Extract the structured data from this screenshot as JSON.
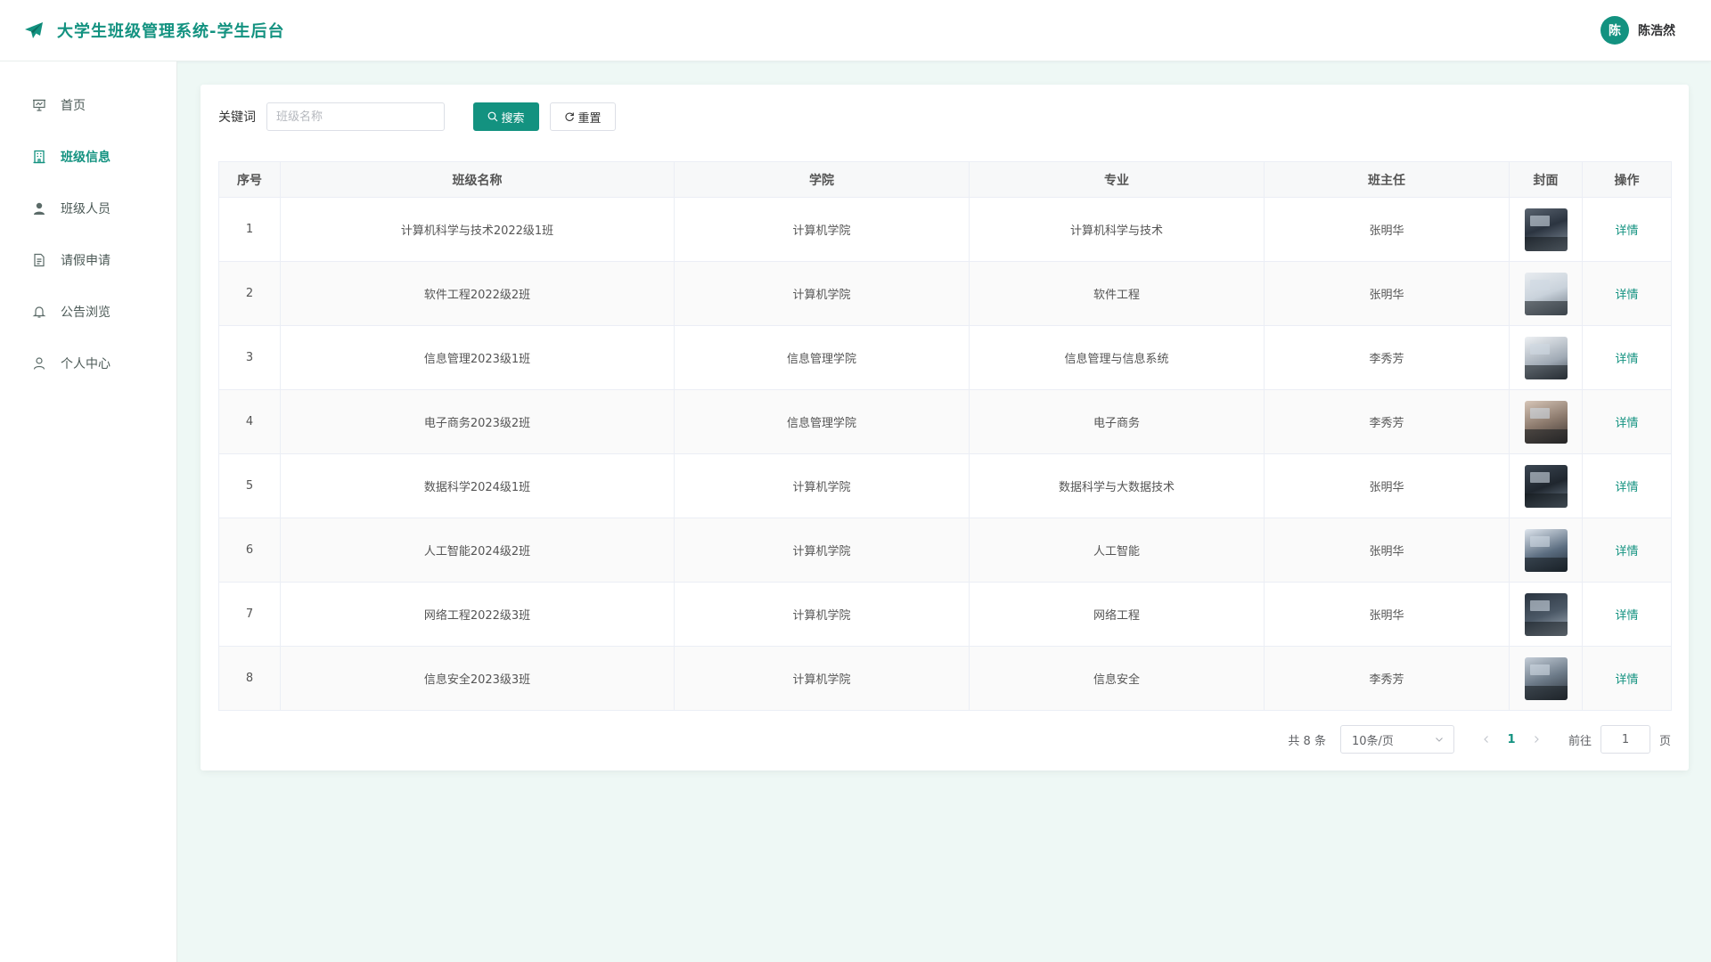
{
  "header": {
    "title": "大学生班级管理系统-学生后台",
    "user_avatar_text": "陈",
    "user_name": "陈浩然",
    "brand_color": "#139280"
  },
  "sidebar": {
    "items": [
      {
        "label": "首页",
        "icon": "presentation-icon"
      },
      {
        "label": "班级信息",
        "icon": "building-icon",
        "active": true
      },
      {
        "label": "班级人员",
        "icon": "user-filled-icon"
      },
      {
        "label": "请假申请",
        "icon": "document-icon"
      },
      {
        "label": "公告浏览",
        "icon": "bell-icon"
      },
      {
        "label": "个人中心",
        "icon": "user-outline-icon"
      }
    ]
  },
  "search": {
    "label": "关键词",
    "placeholder": "班级名称",
    "value": "",
    "search_button": "搜索",
    "reset_button": "重置"
  },
  "table": {
    "headers": [
      "序号",
      "班级名称",
      "学院",
      "专业",
      "班主任",
      "封面",
      "操作"
    ],
    "action_label": "详情",
    "rows": [
      {
        "index": "1",
        "class_name": "计算机科学与技术2022级1班",
        "college": "计算机学院",
        "major": "计算机科学与技术",
        "teacher": "张明华"
      },
      {
        "index": "2",
        "class_name": "软件工程2022级2班",
        "college": "计算机学院",
        "major": "软件工程",
        "teacher": "张明华"
      },
      {
        "index": "3",
        "class_name": "信息管理2023级1班",
        "college": "信息管理学院",
        "major": "信息管理与信息系统",
        "teacher": "李秀芳"
      },
      {
        "index": "4",
        "class_name": "电子商务2023级2班",
        "college": "信息管理学院",
        "major": "电子商务",
        "teacher": "李秀芳"
      },
      {
        "index": "5",
        "class_name": "数据科学2024级1班",
        "college": "计算机学院",
        "major": "数据科学与大数据技术",
        "teacher": "张明华"
      },
      {
        "index": "6",
        "class_name": "人工智能2024级2班",
        "college": "计算机学院",
        "major": "人工智能",
        "teacher": "张明华"
      },
      {
        "index": "7",
        "class_name": "网络工程2022级3班",
        "college": "计算机学院",
        "major": "网络工程",
        "teacher": "张明华"
      },
      {
        "index": "8",
        "class_name": "信息安全2023级3班",
        "college": "计算机学院",
        "major": "信息安全",
        "teacher": "李秀芳"
      }
    ]
  },
  "pagination": {
    "total_text": "共 8 条",
    "page_size": "10条/页",
    "current_page": "1",
    "goto_label": "前往",
    "goto_value": "1",
    "goto_unit": "页"
  }
}
